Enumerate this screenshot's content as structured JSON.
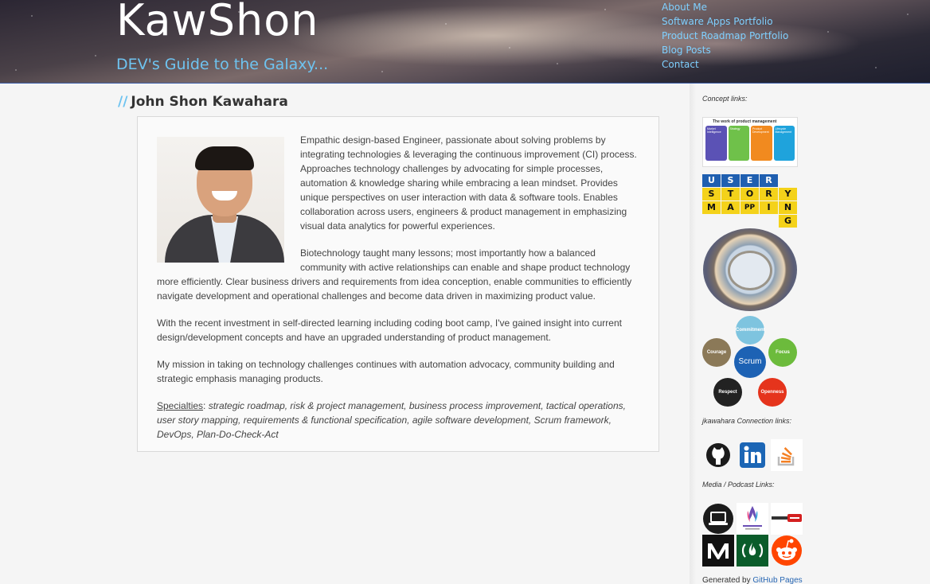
{
  "header": {
    "title": "KawShon",
    "tagline": "DEV's Guide to the Galaxy..."
  },
  "nav": {
    "items": [
      {
        "label": "About Me"
      },
      {
        "label": "Software Apps Portfolio"
      },
      {
        "label": "Product Roadmap Portfolio"
      },
      {
        "label": "Blog Posts"
      },
      {
        "label": "Contact"
      }
    ]
  },
  "main": {
    "heading_prefix": "//",
    "heading": "John Shon Kawahara",
    "paragraphs": [
      "Empathic design-based Engineer, passionate about solving problems by integrating technologies & leveraging the continuous improvement (CI) process. Approaches technology challenges by advocating for simple processes, automation & knowledge sharing while embracing a lean mindset. Provides unique perspectives on user interaction with data & software tools. Enables collaboration across users, engineers & product management in emphasizing visual data analytics for powerful experiences.",
      "Biotechnology taught many lessons; most importantly how a balanced community with active relationships can enable and shape product technology more efficiently. Clear business drivers and requirements from idea conception, enable communities to efficiently navigate development and operational challenges and become data driven in maximizing product value.",
      "With the recent investment in self-directed learning including coding boot camp, I've gained insight into current design/development concepts and have an upgraded understanding of product management.",
      "My mission in taking on technology challenges continues with automation advocacy, community building and strategic emphasis managing products."
    ],
    "specialties_label": "Specialties",
    "specialties_sep": ":",
    "specialties_list": " strategic roadmap, risk & project management, business process improvement, tactical operations, user story mapping, requirements & functional specification, agile software development, Scrum framework, DevOps, Plan-Do-Check-Act"
  },
  "sidebar": {
    "concept_label": "Concept links:",
    "work_card": {
      "title": "The work of product management",
      "columns": [
        {
          "label": "Market Intelligence",
          "color": "#5b52b5"
        },
        {
          "label": "Strategy",
          "color": "#6fc14a"
        },
        {
          "label": "Product Development",
          "color": "#f18a1f"
        },
        {
          "label": "Lifecycle Management",
          "color": "#1fa3dc"
        }
      ]
    },
    "story_mapping": {
      "rows": [
        [
          "U",
          "S",
          "E",
          "R"
        ],
        [
          "S",
          "T",
          "O",
          "R",
          "Y"
        ],
        [
          "M",
          "A",
          "PP",
          "I",
          "N"
        ],
        [
          "G"
        ]
      ]
    },
    "scrum": {
      "center": "Scrum",
      "values": [
        "Commitment",
        "Focus",
        "Openness",
        "Respect",
        "Courage"
      ]
    },
    "connection_label": "jkawahara Connection links:",
    "connection_icons": [
      "github-icon",
      "linkedin-icon",
      "stackoverflow-icon"
    ],
    "media_label": "Media / Podcast Links:",
    "media_icons": [
      "laptop-podcast-icon",
      "screaming-in-the-cloud-icon",
      "threatpost-icon",
      "medium-icon",
      "freecodecamp-icon",
      "reddit-icon"
    ],
    "colors": {
      "linkedin": "#1c66b5",
      "stackoverflow": "#f48024",
      "reddit": "#ff4500",
      "freecodecamp": "#0a5c2a",
      "threatpost": "#d42020"
    }
  },
  "footer": {
    "generated_by": "Generated by",
    "link_label": "GitHub Pages"
  }
}
